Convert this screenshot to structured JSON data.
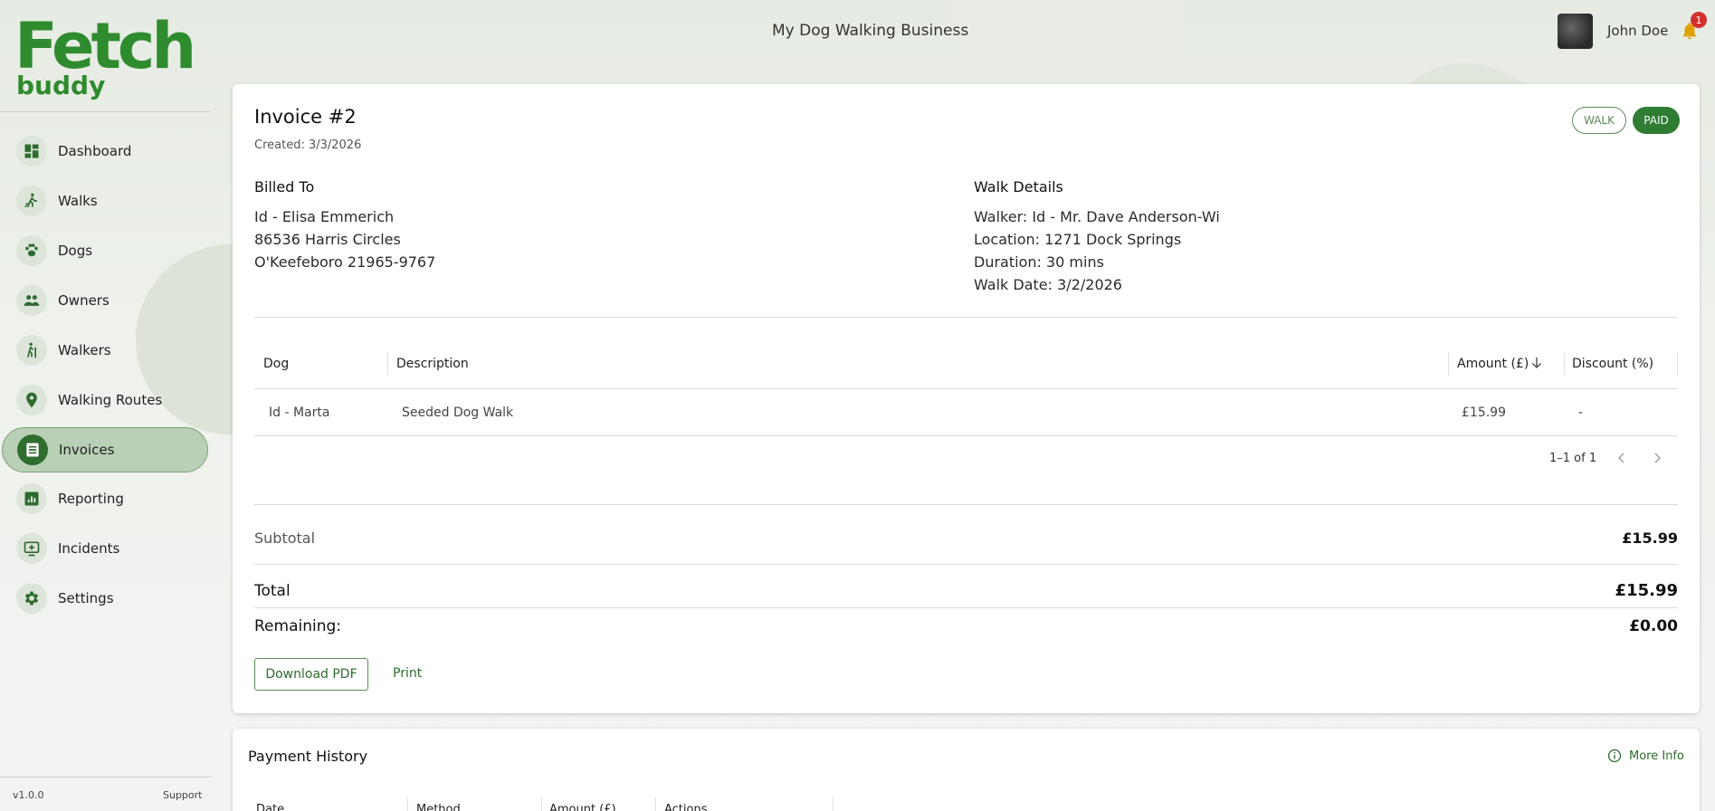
{
  "brand": {
    "logo_main": "Fetch",
    "logo_sub": "buddy",
    "accent": "#2e7d32"
  },
  "header": {
    "business_title": "My Dog Walking Business",
    "user_name": "John Doe",
    "notification_count": "1"
  },
  "sidebar": {
    "items": [
      {
        "label": "Dashboard",
        "icon": "dashboard-icon"
      },
      {
        "label": "Walks",
        "icon": "walk-icon"
      },
      {
        "label": "Dogs",
        "icon": "paw-icon"
      },
      {
        "label": "Owners",
        "icon": "people-icon"
      },
      {
        "label": "Walkers",
        "icon": "hiker-icon"
      },
      {
        "label": "Walking Routes",
        "icon": "location-pin-icon"
      },
      {
        "label": "Invoices",
        "icon": "invoice-icon",
        "active": true
      },
      {
        "label": "Reporting",
        "icon": "chart-icon"
      },
      {
        "label": "Incidents",
        "icon": "monitor-plus-icon"
      },
      {
        "label": "Settings",
        "icon": "gear-icon"
      }
    ],
    "version": "v1.0.0",
    "support": "Support"
  },
  "invoice": {
    "title": "Invoice #2",
    "created": "Created: 3/3/2026",
    "chips": {
      "type": "WALK",
      "status": "PAID"
    },
    "billed_to": {
      "heading": "Billed To",
      "lines": [
        "Id - Elisa Emmerich",
        "86536 Harris Circles",
        "O'Keefeboro 21965-9767"
      ]
    },
    "walk_details": {
      "heading": "Walk Details",
      "lines": [
        "Walker: Id - Mr. Dave Anderson-Wi",
        "Location: 1271 Dock Springs",
        "Duration: 30 mins",
        "Walk Date: 3/2/2026"
      ]
    },
    "table": {
      "headers": {
        "dog": "Dog",
        "description": "Description",
        "amount": "Amount (£)",
        "discount": "Discount (%)"
      },
      "rows": [
        {
          "dog": "Id - Marta",
          "description": "Seeded Dog Walk",
          "amount": "£15.99",
          "discount": "-"
        }
      ],
      "pagination": "1–1 of 1"
    },
    "subtotal_label": "Subtotal",
    "subtotal_value": "£15.99",
    "total_label": "Total",
    "total_value": "£15.99",
    "remaining_label": "Remaining:",
    "remaining_value": "£0.00",
    "download_label": "Download PDF",
    "print_label": "Print"
  },
  "payment_history": {
    "title": "Payment History",
    "more_info": "More Info",
    "headers": {
      "date": "Date",
      "method": "Method",
      "amount": "Amount (£)",
      "actions": "Actions"
    }
  }
}
